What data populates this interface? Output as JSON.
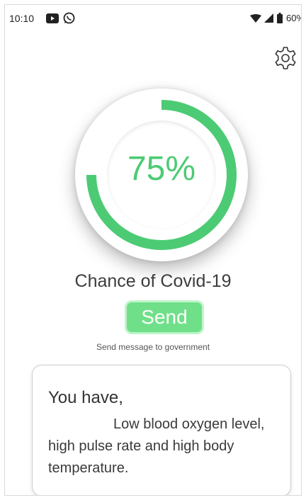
{
  "status_bar": {
    "time": "10:10",
    "battery": "60%",
    "icons": [
      "youtube-icon",
      "whatsapp-icon",
      "wifi-icon",
      "signal-icon",
      "battery-icon"
    ]
  },
  "settings": {
    "icon": "gear-icon"
  },
  "gauge": {
    "value_label": "75%",
    "progress": 0.75,
    "color": "#4ccb74",
    "track_color": "#ffffff"
  },
  "caption": "Chance of Covid-19",
  "send_button": {
    "label": "Send",
    "color": "#6fe089"
  },
  "send_hint": "Send message to government",
  "message": {
    "heading": "You have,",
    "body": "Low blood oxygen level, high pulse rate and high body temperature."
  }
}
